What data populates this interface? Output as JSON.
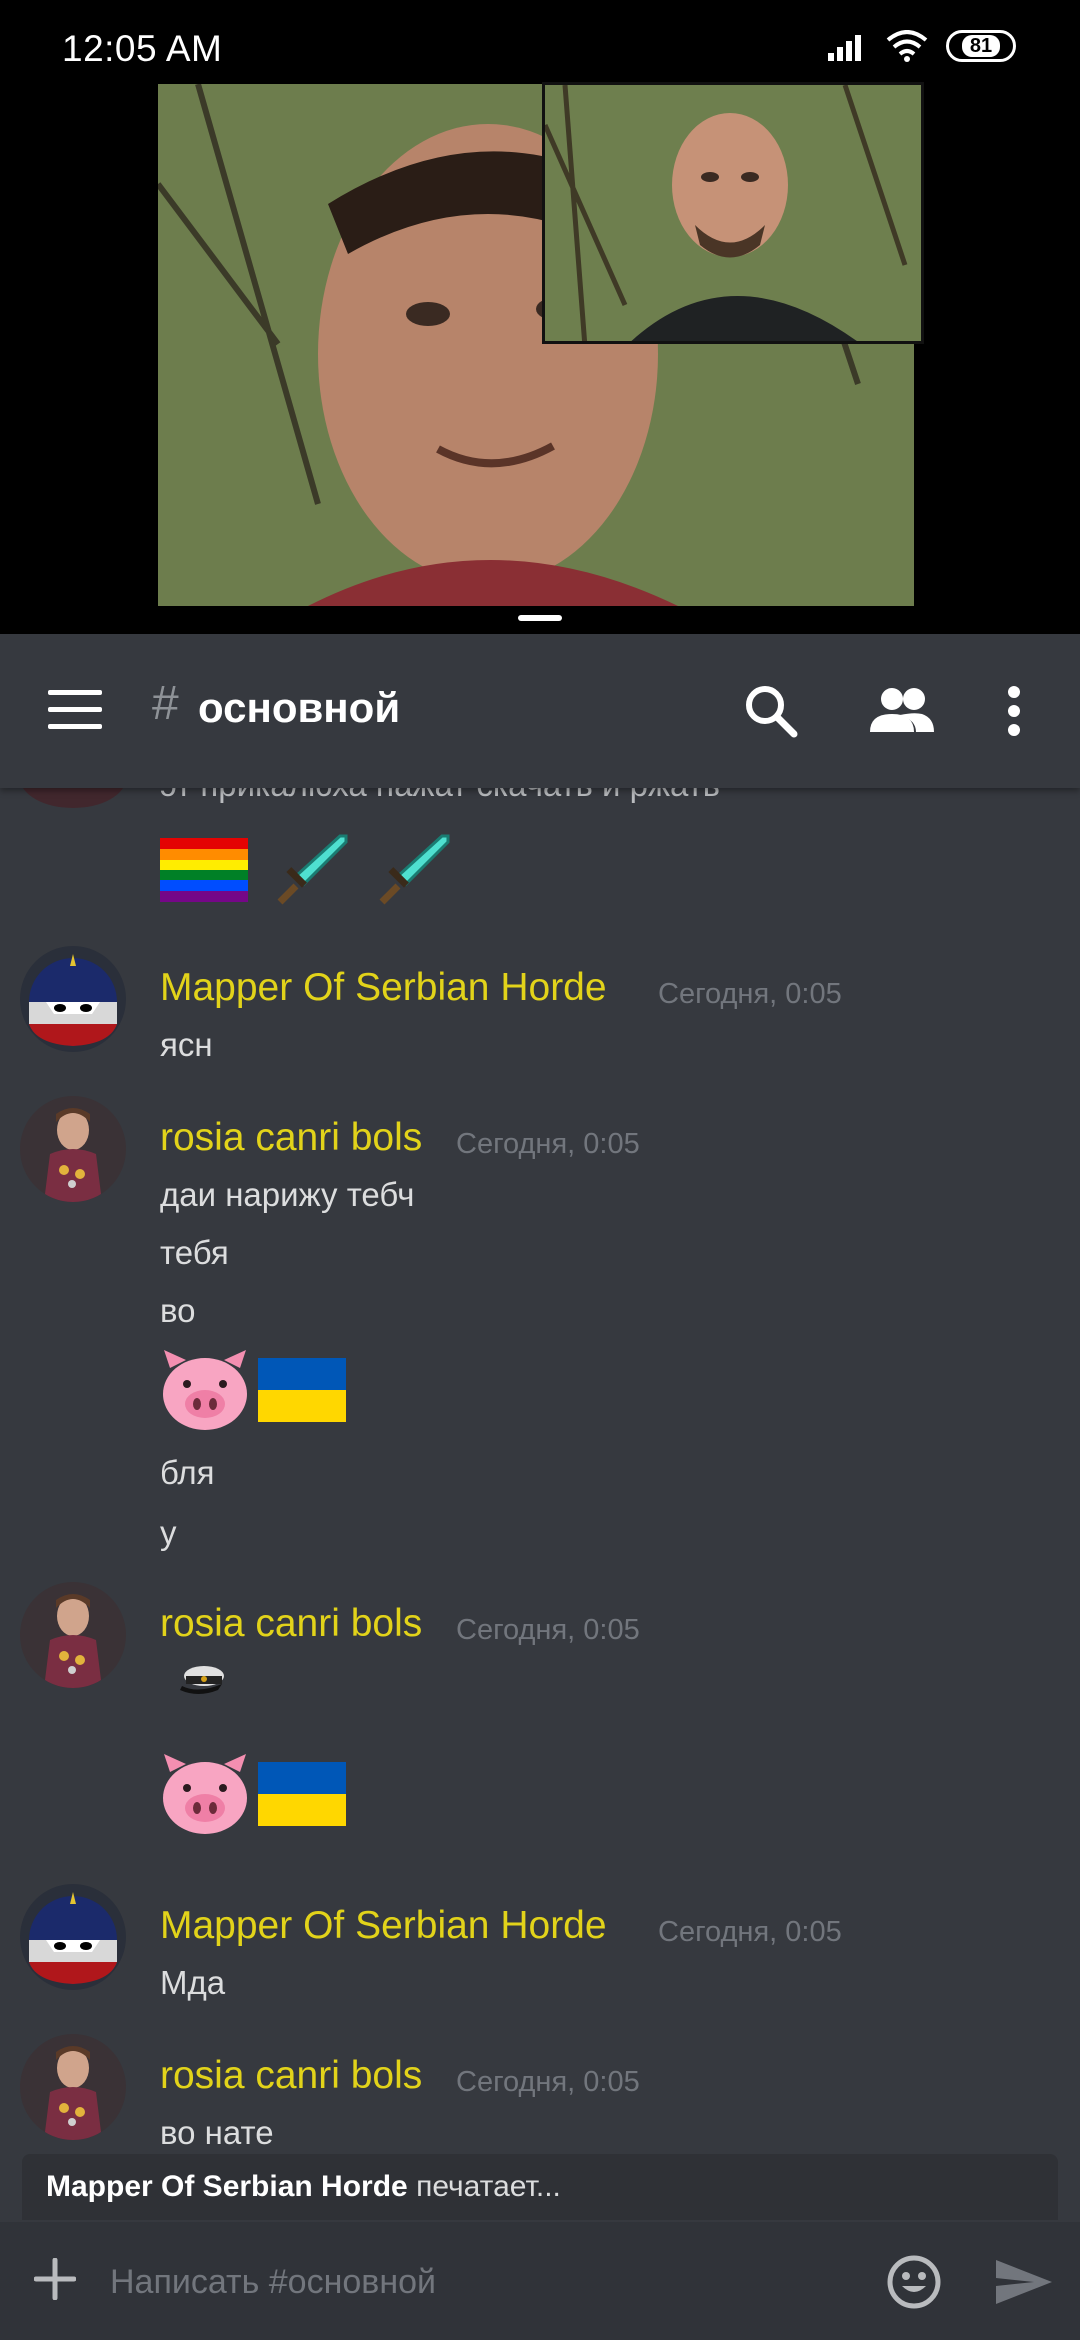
{
  "status_bar": {
    "time": "12:05  AM",
    "battery": "81"
  },
  "channel": {
    "hash": "#",
    "name": "основной"
  },
  "messages": [
    {
      "lines": [
        "эт прикалюха нажат скачать и ржать"
      ]
    },
    {
      "author": "Mapper Of Serbian Horde",
      "timestamp": "Сегодня, 0:05",
      "lines": [
        "ясн"
      ]
    },
    {
      "author": "rosia canri bols",
      "timestamp": "Сегодня, 0:05",
      "lines": [
        "даи нарижу тебч",
        "тебя",
        "во",
        "бля",
        "у"
      ]
    },
    {
      "author": "rosia canri bols",
      "timestamp": "Сегодня, 0:05"
    },
    {
      "author": "Mapper Of Serbian Horde",
      "timestamp": "Сегодня, 0:05",
      "lines": [
        "Мда"
      ]
    },
    {
      "author": "rosia canri bols",
      "timestamp": "Сегодня, 0:05",
      "lines": [
        "во нате"
      ]
    }
  ],
  "typing": {
    "user": "Mapper Of Serbian Horde",
    "text": "печатает..."
  },
  "input": {
    "placeholder": "Написать #основной"
  },
  "colors": {
    "background": "#36393f",
    "username": "#e2d31a",
    "timestamp": "#72767d",
    "input_bar": "#303339"
  }
}
